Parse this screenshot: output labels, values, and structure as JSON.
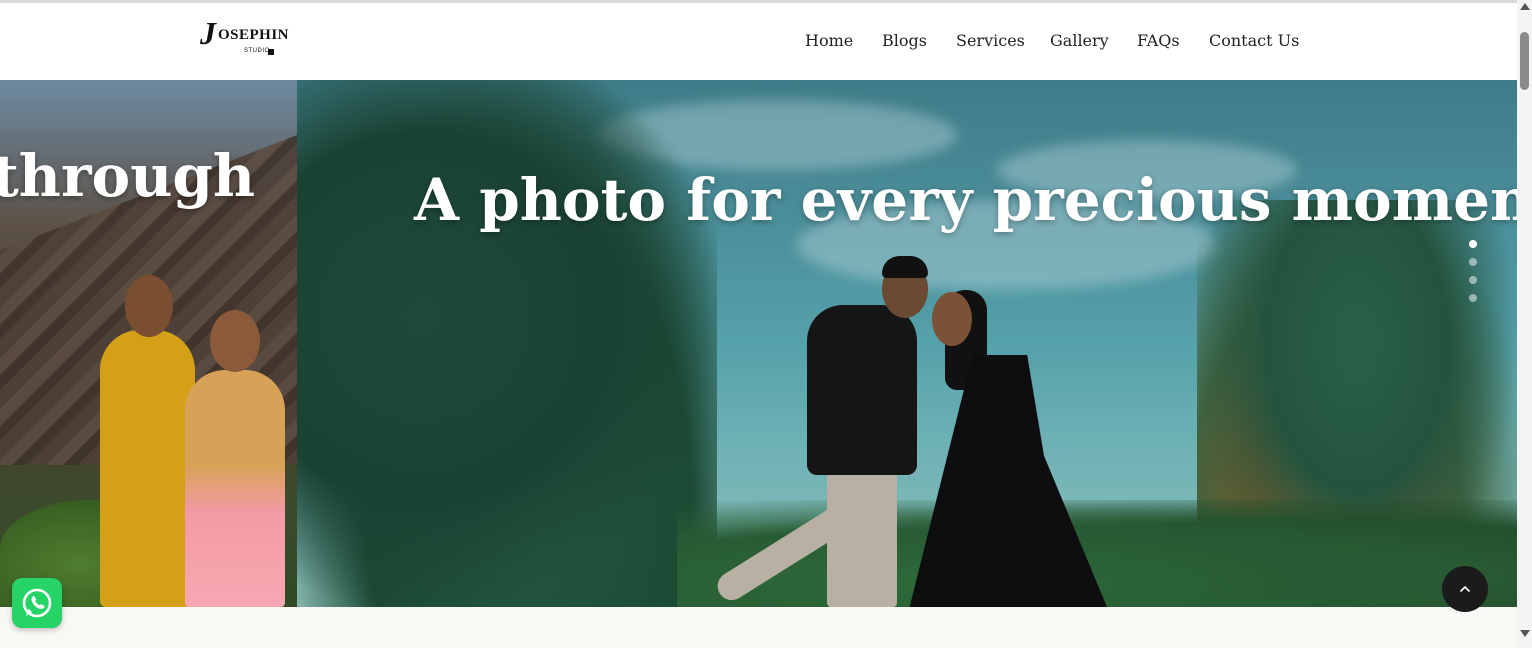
{
  "header": {
    "logo": {
      "initial": "J",
      "word": "OSEPHIN",
      "tagline": "STUDIO"
    },
    "nav": [
      {
        "label": "Home"
      },
      {
        "label": "Blogs"
      },
      {
        "label": "Services"
      },
      {
        "label": "Gallery"
      },
      {
        "label": "FAQs"
      },
      {
        "label": "Contact Us"
      }
    ]
  },
  "hero": {
    "prev_slide_text": "through",
    "current_slide_text": "A photo for every precious moment of yo",
    "slider_dots": {
      "count": 4,
      "active_index": 0
    }
  },
  "floating": {
    "whatsapp_icon": "whatsapp-icon",
    "back_to_top_icon": "chevron-up-icon"
  },
  "colors": {
    "whatsapp": "#25d366",
    "back_to_top": "#1b1b1b",
    "nav_text": "#222222"
  }
}
